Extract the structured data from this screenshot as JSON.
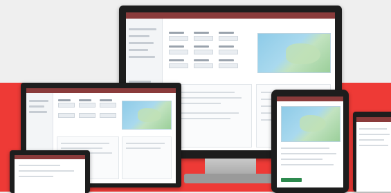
{
  "scene": {
    "background_top_color": "#efefef",
    "background_band_color": "#ee3a36",
    "device_frame_color": "#1d1d1d",
    "app_header_color": "#8a3b3b",
    "devices": [
      {
        "kind": "monitor"
      },
      {
        "kind": "laptop"
      },
      {
        "kind": "phone"
      },
      {
        "kind": "tablet"
      },
      {
        "kind": "phone-partial"
      }
    ],
    "icons": [
      "map-icon"
    ]
  }
}
